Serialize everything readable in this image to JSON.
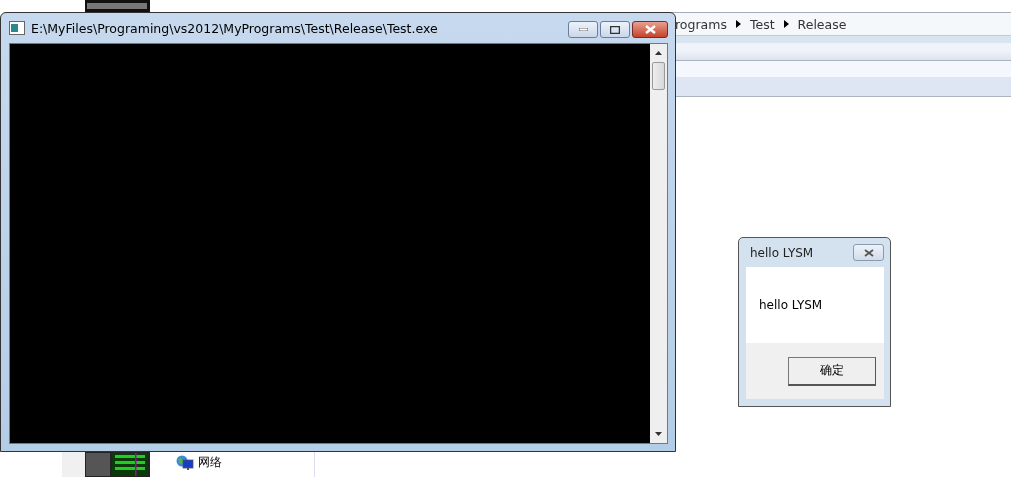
{
  "explorer": {
    "breadcrumb": [
      "rograms",
      "Test",
      "Release"
    ],
    "nav_items": [
      {
        "label": "网络"
      }
    ]
  },
  "console_window": {
    "title": "E:\\MyFiles\\Programing\\vs2012\\MyPrograms\\Test\\Release\\Test.exe"
  },
  "message_box": {
    "title": "hello LYSM",
    "message": "hello LYSM",
    "buttons": [
      "确定"
    ]
  }
}
